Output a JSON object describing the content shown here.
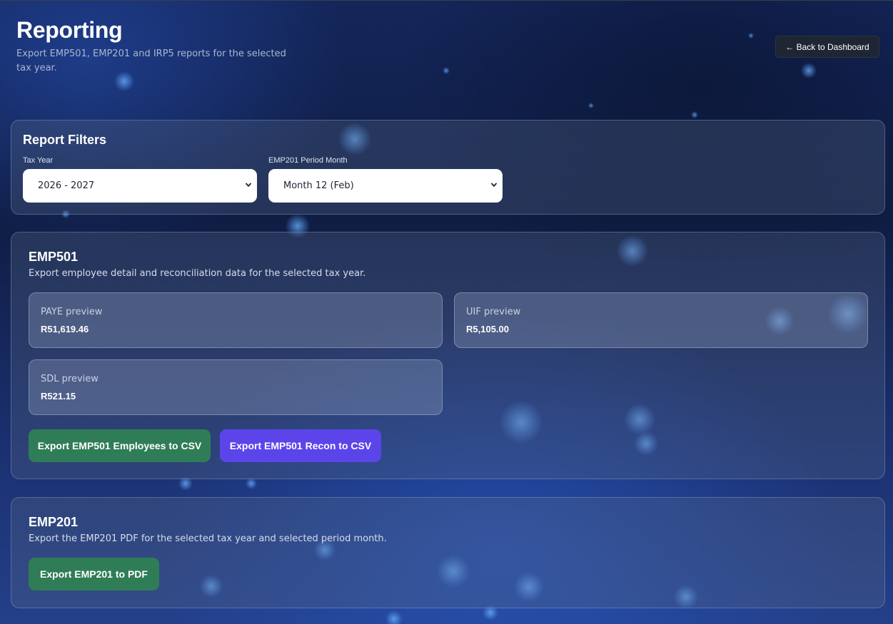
{
  "header": {
    "title": "Reporting",
    "subtitle": "Export EMP501, EMP201 and IRP5 reports for the selected tax year.",
    "back_button_label": "← Back to Dashboard"
  },
  "filters": {
    "heading": "Report Filters",
    "tax_year": {
      "label": "Tax Year",
      "selected": "2026 - 2027",
      "icon": "chevron-down-icon"
    },
    "period_month": {
      "label": "EMP201 Period Month",
      "selected": "Month 12 (Feb)",
      "icon": "chevron-down-icon"
    }
  },
  "emp501": {
    "heading": "EMP501",
    "description": "Export employee detail and reconciliation data for the selected tax year.",
    "previews": [
      {
        "label": "PAYE preview",
        "value": "R51,619.46"
      },
      {
        "label": "UIF preview",
        "value": "R5,105.00"
      },
      {
        "label": "SDL preview",
        "value": "R521.15"
      }
    ],
    "buttons": {
      "employees_csv": "Export EMP501 Employees to CSV",
      "recon_csv": "Export EMP501 Recon to CSV"
    }
  },
  "emp201": {
    "heading": "EMP201",
    "description": "Export the EMP201 PDF for the selected tax year and selected period month.",
    "buttons": {
      "pdf": "Export EMP201 to PDF"
    }
  },
  "colors": {
    "primary_green": "#2f7d57",
    "primary_purple": "#5b45ea",
    "back_button_bg": "#1f2633"
  }
}
